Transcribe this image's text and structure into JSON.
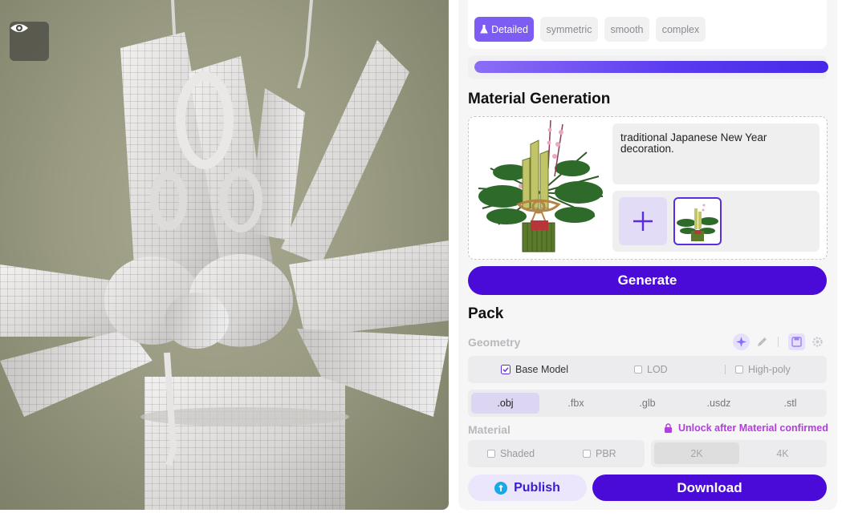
{
  "viewport": {
    "toggle_icon": "eye-icon"
  },
  "style_chips": [
    {
      "label": "Detailed",
      "active": true,
      "icon": "flask-icon"
    },
    {
      "label": "symmetric",
      "active": false
    },
    {
      "label": "smooth",
      "active": false
    },
    {
      "label": "complex",
      "active": false
    }
  ],
  "progress": {
    "fraction": 1.0
  },
  "material": {
    "title": "Material Generation",
    "prompt": "traditional Japanese New Year decoration.",
    "add_icon": "plus-icon",
    "generate_label": "Generate"
  },
  "pack": {
    "title": "Pack",
    "geometry_label": "Geometry",
    "geometry_options": [
      {
        "label": "Base Model",
        "checked": true
      },
      {
        "label": "LOD",
        "checked": false
      },
      {
        "label": "High-poly",
        "checked": false
      }
    ],
    "formats": [
      ".obj",
      ".fbx",
      ".glb",
      ".usdz",
      ".stl"
    ],
    "selected_format": ".obj",
    "material_label": "Material",
    "unlock_text": "Unlock after Material confirmed",
    "material_options": [
      {
        "label": "Shaded",
        "checked": false
      },
      {
        "label": "PBR",
        "checked": false
      }
    ],
    "resolutions": [
      "2K",
      "4K"
    ],
    "selected_resolution": "2K"
  },
  "actions": {
    "publish_label": "Publish",
    "download_label": "Download"
  },
  "colors": {
    "accent": "#4a0bd9",
    "chip_active": "#7c5cf3",
    "unlock_text": "#b43ce0"
  }
}
